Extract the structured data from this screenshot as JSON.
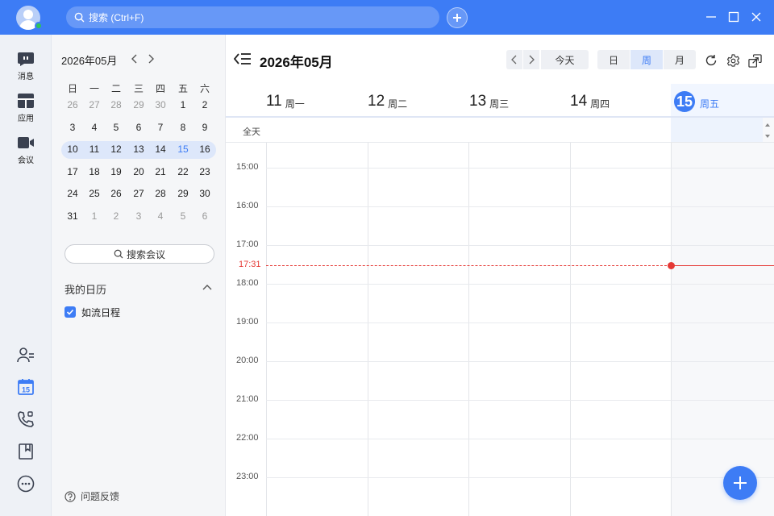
{
  "topbar": {
    "search_placeholder": "搜索 (Ctrl+F)",
    "accent_color": "#3d7cf5"
  },
  "rail": {
    "items": [
      {
        "label": "消息",
        "icon": "message-icon"
      },
      {
        "label": "应用",
        "icon": "apps-icon"
      },
      {
        "label": "会议",
        "icon": "video-icon"
      }
    ],
    "bottom_icons": [
      "contacts-icon",
      "calendar-icon",
      "phone-icon",
      "bookmark-icon",
      "more-icon"
    ],
    "calendar_icon_day": "15"
  },
  "mini_calendar": {
    "title": "2026年05月",
    "weekdays": [
      "日",
      "一",
      "二",
      "三",
      "四",
      "五",
      "六"
    ],
    "weeks": [
      [
        "26",
        "27",
        "28",
        "29",
        "30",
        "1",
        "2"
      ],
      [
        "3",
        "4",
        "5",
        "6",
        "7",
        "8",
        "9"
      ],
      [
        "10",
        "11",
        "12",
        "13",
        "14",
        "15",
        "16"
      ],
      [
        "17",
        "18",
        "19",
        "20",
        "21",
        "22",
        "23"
      ],
      [
        "24",
        "25",
        "26",
        "27",
        "28",
        "29",
        "30"
      ],
      [
        "31",
        "1",
        "2",
        "3",
        "4",
        "5",
        "6"
      ]
    ],
    "search_meeting": "搜索会议",
    "my_calendars_title": "我的日历",
    "calendars": [
      {
        "name": "如流日程",
        "checked": true
      }
    ],
    "feedback": "问题反馈"
  },
  "main": {
    "title": "2026年05月",
    "today_button": "今天",
    "views": [
      "日",
      "周",
      "月"
    ],
    "active_view": "周",
    "days": [
      {
        "num": "11",
        "weekday": "周一"
      },
      {
        "num": "12",
        "weekday": "周二"
      },
      {
        "num": "13",
        "weekday": "周三"
      },
      {
        "num": "14",
        "weekday": "周四"
      },
      {
        "num": "15",
        "weekday": "周五",
        "today": true
      }
    ],
    "all_day_label": "全天",
    "times": [
      "15:00",
      "16:00",
      "17:00",
      "18:00",
      "19:00",
      "20:00",
      "21:00",
      "22:00",
      "23:00"
    ],
    "current_time": "17:31",
    "now_color": "#e53935"
  }
}
